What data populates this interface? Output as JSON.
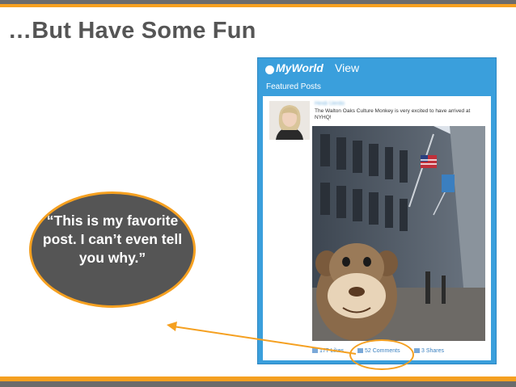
{
  "slide": {
    "title": "…But Have Some Fun"
  },
  "app": {
    "brand": "MyWorld",
    "view_label": "View",
    "section": "Featured Posts",
    "post": {
      "author": "Heidi Uerdo",
      "text": "The Walton Oaks Culture Monkey is very excited to have arrived at NYHQ!",
      "likes": "177 Likes",
      "comments": "52 Comments",
      "shares": "3 Shares"
    }
  },
  "callout": {
    "quote": "“This is my favorite post. I can’t even tell you why.”"
  },
  "colors": {
    "accent": "#f5a020",
    "brand_blue": "#3a9fdc",
    "bubble": "#555555",
    "title": "#555555"
  }
}
